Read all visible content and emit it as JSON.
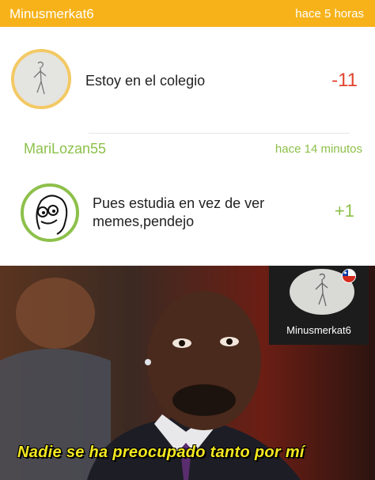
{
  "header": {
    "username": "Minusmerkat6",
    "time": "hace 5 horas"
  },
  "comment_1": {
    "text": "Estoy en el colegio",
    "score": "-11",
    "avatar_icon": "sketch-figure-icon"
  },
  "reply_header": {
    "username": "MariLozan55",
    "time": "hace 14 minutos"
  },
  "comment_2": {
    "text": "Pues estudia en vez de ver memes,pendejo",
    "score": "+1",
    "avatar_icon": "meme-face-icon"
  },
  "meme": {
    "caption": "Nadie se ha preocupado tanto por mí",
    "watermark_username": "Minusmerkat6",
    "watermark_flag_icon": "chile-flag-icon"
  },
  "colors": {
    "header_orange": "#f7b21a",
    "negative_red": "#e0452c",
    "positive_green": "#8dc04a",
    "caption_yellow": "#f4e820"
  }
}
